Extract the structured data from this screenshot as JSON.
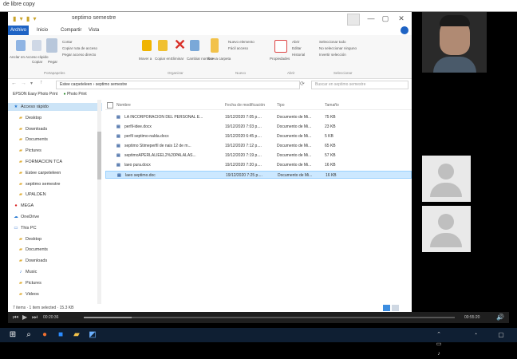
{
  "window": {
    "top_label": "de libre copy",
    "explorer_title": "septimo semestre",
    "min": "—",
    "max": "▢",
    "close": "✕"
  },
  "ribbon": {
    "tabs": [
      "Archivo",
      "Inicio",
      "Compartir",
      "Vista"
    ],
    "buttons": [
      "Anclar en Acceso rápido",
      "Copiar",
      "Pegar",
      "Cortar",
      "Copiar ruta de acceso",
      "Pegar acceso directo",
      "Mover a",
      "Copiar en",
      "Eliminar",
      "Cambiar nombre",
      "Nueva carpeta",
      "Nuevo elemento",
      "Fácil acceso",
      "Propiedades",
      "Abrir",
      "Editar",
      "Historial",
      "Seleccionar todo",
      "No seleccionar ninguno",
      "Invertir selección"
    ],
    "groups": [
      "Portapapeles",
      "Organizar",
      "Nuevo",
      "Abrir",
      "Seleccionar"
    ]
  },
  "address": {
    "path": "Estee carpeteleen › septimo semestre",
    "search_placeholder": "Buscar en septimo semestre"
  },
  "epson_bar": {
    "easy_photo": "EPSON Easy Photo Print",
    "photo_print": "Photo Print"
  },
  "nav": {
    "items": [
      {
        "icon": "star-icon",
        "label": "Acceso rápido",
        "selected": true
      },
      {
        "icon": "folder-icon",
        "label": "Desktop"
      },
      {
        "icon": "folder-icon",
        "label": "Downloads"
      },
      {
        "icon": "folder-icon",
        "label": "Documents"
      },
      {
        "icon": "folder-icon",
        "label": "Pictures"
      },
      {
        "icon": "folder-icon",
        "label": "FORMACION TCA"
      },
      {
        "icon": "folder-icon",
        "label": "Estee carpeteleen"
      },
      {
        "icon": "folder-icon",
        "label": "septimo semestre"
      },
      {
        "icon": "folder-icon",
        "label": "UPALDEN"
      },
      {
        "icon": "red-circle-icon",
        "label": "MEGA"
      },
      {
        "icon": "cloud-icon",
        "label": "OneDrive"
      },
      {
        "icon": "pc-icon",
        "label": "This PC"
      },
      {
        "icon": "folder-icon",
        "label": "Desktop"
      },
      {
        "icon": "folder-icon",
        "label": "Documents"
      },
      {
        "icon": "folder-icon",
        "label": "Downloads"
      },
      {
        "icon": "music-icon",
        "label": "Music"
      },
      {
        "icon": "folder-icon",
        "label": "Pictures"
      },
      {
        "icon": "folder-icon",
        "label": "Videos"
      }
    ]
  },
  "list": {
    "headers": [
      "Nombre",
      "Fecha de modificación",
      "Tipo",
      "Tamaño"
    ],
    "rows": [
      {
        "name": "LA INCORPORACION DEL PERSONAL E...",
        "date": "19/12/2020 7:05 p....",
        "type": "Documento de Mi...",
        "size": "75 KB"
      },
      {
        "name": "perfil-idee.docx",
        "date": "19/12/2020 7:03 p....",
        "type": "Documento de Mi...",
        "size": "23 KB"
      },
      {
        "name": "perfil septimo-nalda.docx",
        "date": "19/12/2020 6:45 p....",
        "type": "Documento de Mi...",
        "size": "5 KB"
      },
      {
        "name": "septimo Stimeperfil de nais 12 de m...",
        "date": "19/12/2020 7:12 p....",
        "type": "Documento de Mi...",
        "size": "65 KB"
      },
      {
        "name": "septimoAPERLALIEEL2%20PALALAS...",
        "date": "19/12/2020 7:19 p....",
        "type": "Documento de Mi...",
        "size": "57 KB"
      },
      {
        "name": "laeo pura.docx",
        "date": "19/12/2020 7:20 p....",
        "type": "Documento de Mi...",
        "size": "16 KB"
      },
      {
        "name": "laeo septimo.doc",
        "date": "19/12/2020 7:25 p....",
        "type": "Documento de Mi...",
        "size": "16 KB",
        "selected": true
      }
    ]
  },
  "status": {
    "text": "7 items · 1 item selected · 15.3 KB"
  },
  "player": {
    "time_left": "00:20:36",
    "time_right": "00:55:20",
    "play": "▶",
    "prev": "⏮",
    "next": "⏭"
  }
}
